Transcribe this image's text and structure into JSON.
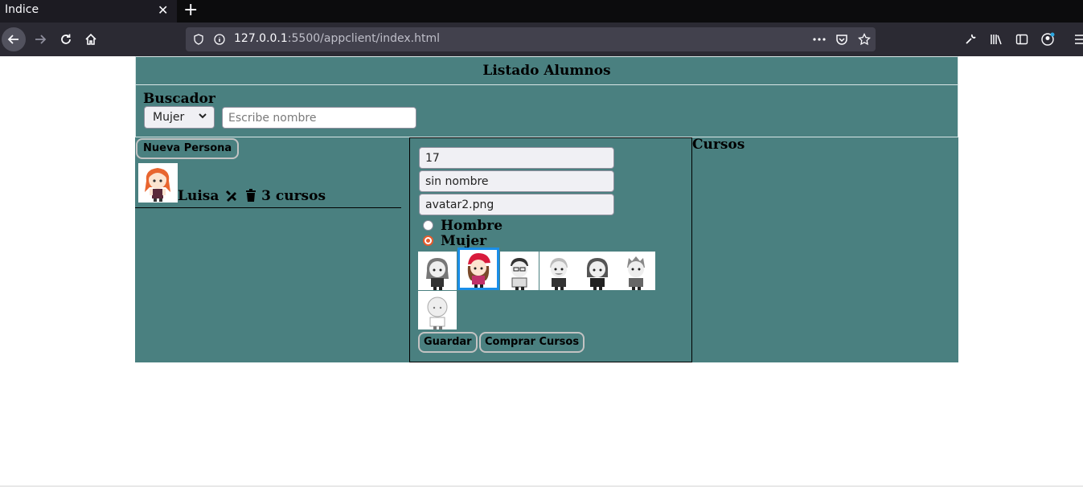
{
  "browser": {
    "tab_title": "Indice",
    "tab_close": "✕",
    "new_tab": "+",
    "url_host": "127.0.0.1",
    "url_rest": ":5500/appclient/index.html"
  },
  "page": {
    "title": "Listado Alumnos",
    "search": {
      "title": "Buscador",
      "gender_selected": "Mujer",
      "placeholder": "Escribe nombre"
    },
    "list": {
      "new_button": "Nueva Persona",
      "people": [
        {
          "name": "Luisa",
          "courses": "3 cursos"
        }
      ]
    },
    "form": {
      "id_value": "17",
      "name_value": "sin nombre",
      "avatar_value": "avatar2.png",
      "radio_hombre": "Hombre",
      "radio_mujer": "Mujer",
      "save_button": "Guardar",
      "buy_button": "Comprar Cursos"
    },
    "courses": {
      "title": "Cursos"
    }
  }
}
